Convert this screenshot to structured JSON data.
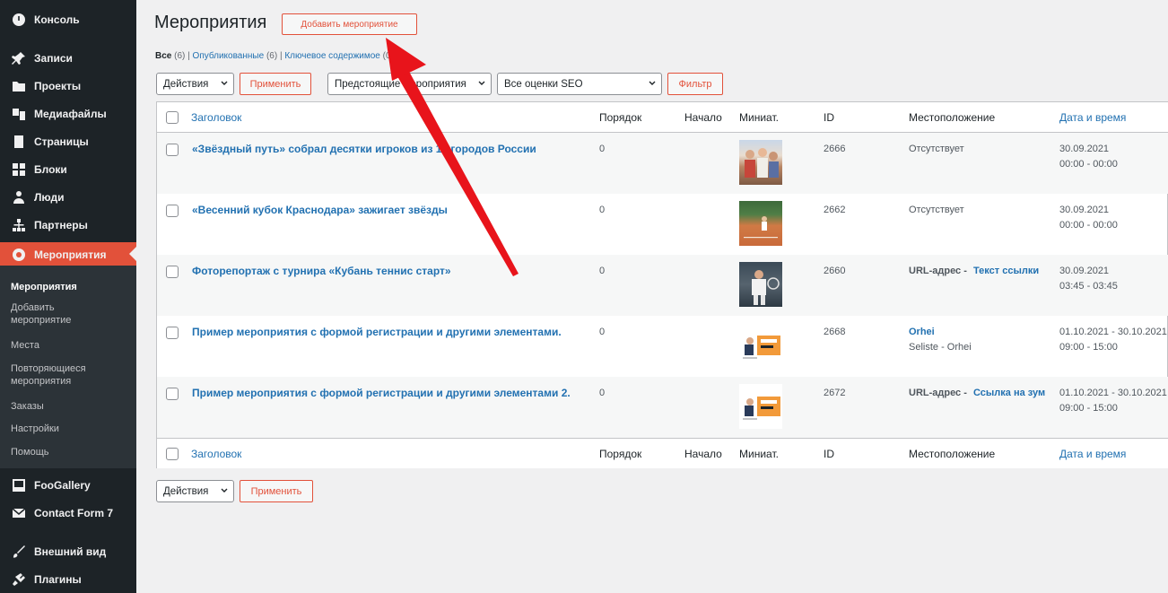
{
  "sidebar": {
    "items": [
      {
        "label": "Консоль",
        "icon": "dashboard-icon"
      },
      {
        "label": "Записи",
        "icon": "pin-icon"
      },
      {
        "label": "Проекты",
        "icon": "folder-icon"
      },
      {
        "label": "Медиафайлы",
        "icon": "media-icon"
      },
      {
        "label": "Страницы",
        "icon": "page-icon"
      },
      {
        "label": "Блоки",
        "icon": "blocks-icon"
      },
      {
        "label": "Люди",
        "icon": "people-icon"
      },
      {
        "label": "Партнеры",
        "icon": "network-icon"
      },
      {
        "label": "Мероприятия",
        "icon": "events-icon"
      },
      {
        "label": "FooGallery",
        "icon": "gallery-icon"
      },
      {
        "label": "Contact Form 7",
        "icon": "mail-icon"
      },
      {
        "label": "Внешний вид",
        "icon": "brush-icon"
      },
      {
        "label": "Плагины",
        "icon": "plugin-icon"
      }
    ],
    "submenu": [
      {
        "label": "Мероприятия"
      },
      {
        "label": "Добавить мероприятие"
      },
      {
        "label": "Места"
      },
      {
        "label": "Повторяющиеся мероприятия"
      },
      {
        "label": "Заказы"
      },
      {
        "label": "Настройки"
      },
      {
        "label": "Помощь"
      }
    ]
  },
  "header": {
    "title": "Мероприятия",
    "add_button": "Добавить мероприятие"
  },
  "filters": {
    "all": "Все",
    "all_count": "(6)",
    "published": "Опубликованные",
    "published_count": "(6)",
    "keyword": "Ключевое содержимое",
    "keyword_count": "(0)",
    "sep": "|",
    "bulk_action": "Действия",
    "apply": "Применить",
    "scope": "Предстоящие мероприятия",
    "seo": "Все оценки SEO",
    "filter_button": "Фильтр"
  },
  "columns": {
    "title": "Заголовок",
    "order": "Порядок",
    "start": "Начало",
    "thumb": "Миниат.",
    "id": "ID",
    "location": "Местоположение",
    "datetime": "Дата и время"
  },
  "rows": [
    {
      "title": "«Звёздный путь» собрал десятки игроков из 17 городов России",
      "order": "0",
      "id": "2666",
      "location": "Отсутствует",
      "location_link": "",
      "location_sub": "",
      "date": "30.09.2021",
      "time": "00:00 - 00:00",
      "thumb": "photo-kids-icon"
    },
    {
      "title": "«Весенний кубок Краснодара» зажигает звёзды",
      "order": "0",
      "id": "2662",
      "location": "Отсутствует",
      "location_link": "",
      "location_sub": "",
      "date": "30.09.2021",
      "time": "00:00 - 00:00",
      "thumb": "photo-court-icon"
    },
    {
      "title": "Фоторепортаж с турнира «Кубань теннис старт»",
      "order": "0",
      "id": "2660",
      "location": "URL-адрес - ",
      "location_link": "Текст ссылки",
      "location_sub": "",
      "date": "30.09.2021",
      "time": "03:45 - 03:45",
      "thumb": "photo-player-icon"
    },
    {
      "title": "Пример мероприятия с формой регистрации и другими элементами.",
      "order": "0",
      "id": "2668",
      "location": "",
      "location_link": "Orhei",
      "location_sub": "Seliste - Orhei",
      "date": "01.10.2021 - 30.10.2021",
      "time": "09:00 - 15:00",
      "thumb": "banner-icon"
    },
    {
      "title": "Пример мероприятия с формой регистрации и другими элементами 2.",
      "order": "0",
      "id": "2672",
      "location": "URL-адрес - ",
      "location_link": "Ссылка на зум",
      "location_sub": "",
      "date": "01.10.2021 - 30.10.2021",
      "time": "09:00 - 15:00",
      "thumb": "banner-icon"
    }
  ],
  "colors": {
    "accent": "#e2513a",
    "link": "#2271b1",
    "sidebar": "#1d2327",
    "arrow": "#e8141b"
  }
}
